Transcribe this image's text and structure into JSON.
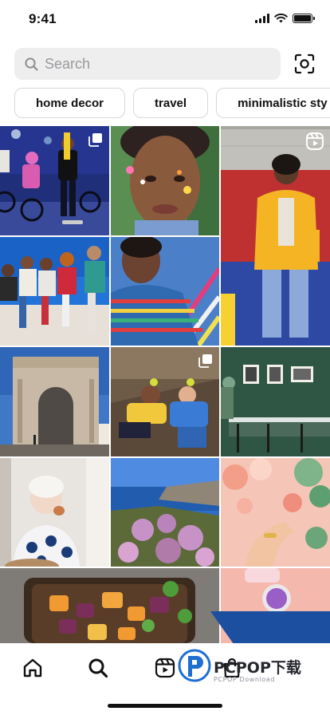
{
  "status_bar": {
    "time": "9:41"
  },
  "search": {
    "placeholder": "Search",
    "value": ""
  },
  "chips": [
    {
      "label": "home decor"
    },
    {
      "label": "travel"
    },
    {
      "label": "minimalistic sty"
    }
  ],
  "grid": {
    "tiles": [
      {
        "subject": "kids-on-bikes",
        "badge": "carousel"
      },
      {
        "subject": "face-paint-portrait",
        "badge": "none"
      },
      {
        "subject": "man-yellow-jacket",
        "badge": "reels"
      },
      {
        "subject": "friends-on-wall",
        "badge": "none"
      },
      {
        "subject": "striped-shirt-man",
        "badge": "none"
      },
      {
        "subject": "triumphal-arch",
        "badge": "none"
      },
      {
        "subject": "couple-on-rocks",
        "badge": "carousel"
      },
      {
        "subject": "green-dining-room",
        "badge": "none"
      },
      {
        "subject": "woman-eating",
        "badge": "none"
      },
      {
        "subject": "coastline-flowers",
        "badge": "none"
      },
      {
        "subject": "flowers-hand",
        "badge": "none"
      },
      {
        "subject": "roasted-vegetables",
        "badge": "none"
      },
      {
        "subject": "makeup-powder",
        "badge": "none"
      }
    ]
  },
  "bottom_nav": {
    "items": [
      {
        "icon": "home-icon"
      },
      {
        "icon": "search-icon"
      },
      {
        "icon": "reels-icon"
      },
      {
        "icon": "shop-icon"
      }
    ]
  },
  "watermark": {
    "brand": "PCPOP下载",
    "sub": "PCPOP Download"
  },
  "colors": {
    "accent": "#111111",
    "chip_border": "#d8d8dc",
    "search_bg": "#eeeeef",
    "watermark_blue": "#1c4fa0"
  }
}
